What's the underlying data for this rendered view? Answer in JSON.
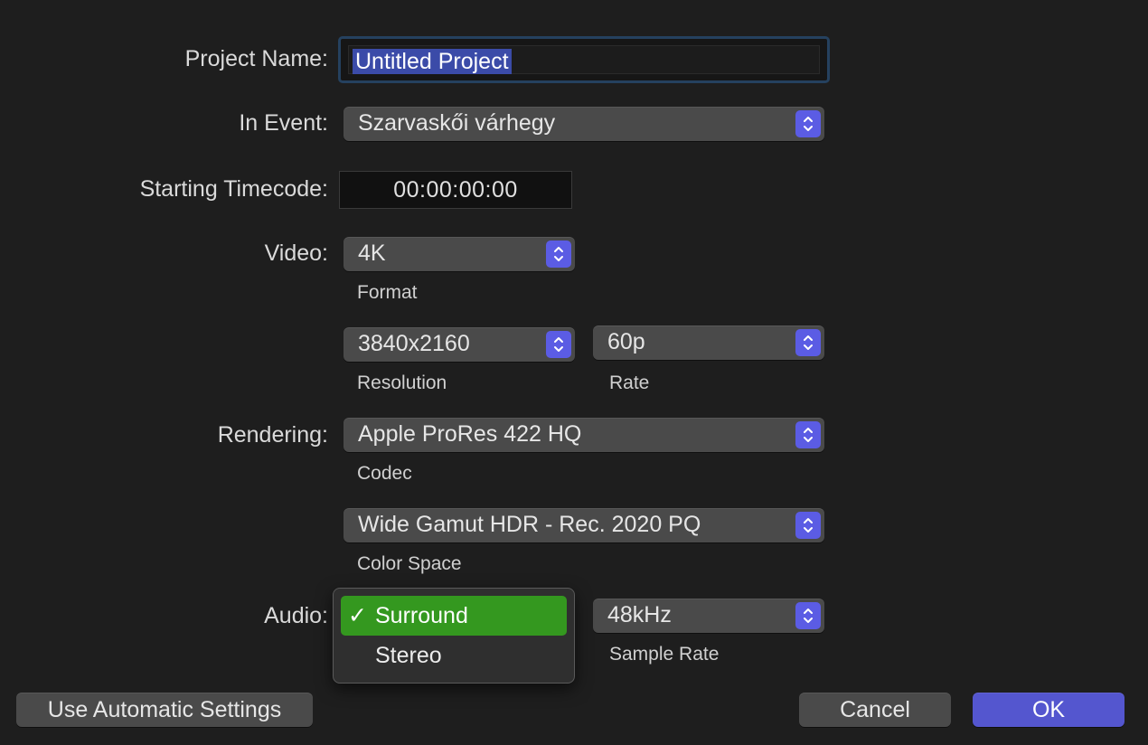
{
  "accent_color": "#5b5ce4",
  "selection_color": "#3b4ba8",
  "menu_highlight_color": "#34981f",
  "fields": {
    "project_name": {
      "label": "Project Name:",
      "value": "Untitled Project"
    },
    "in_event": {
      "label": "In Event:",
      "value": "Szarvaskői várhegy"
    },
    "starting_timecode": {
      "label": "Starting Timecode:",
      "value": "00:00:00:00"
    }
  },
  "video": {
    "label": "Video:",
    "format": {
      "value": "4K",
      "caption": "Format"
    },
    "resolution": {
      "value": "3840x2160",
      "caption": "Resolution"
    },
    "rate": {
      "value": "60p",
      "caption": "Rate"
    }
  },
  "rendering": {
    "label": "Rendering:",
    "codec": {
      "value": "Apple ProRes 422 HQ",
      "caption": "Codec"
    },
    "color_space": {
      "value": "Wide Gamut HDR - Rec. 2020 PQ",
      "caption": "Color Space"
    }
  },
  "audio": {
    "label": "Audio:",
    "menu_options": [
      {
        "label": "Surround",
        "selected": true,
        "check": "✓"
      },
      {
        "label": "Stereo",
        "selected": false
      }
    ],
    "sample_rate": {
      "value": "48kHz",
      "caption": "Sample Rate"
    }
  },
  "buttons": {
    "automatic": "Use Automatic Settings",
    "cancel": "Cancel",
    "ok": "OK"
  },
  "icons": {
    "popup_arrows": "chevron-up-down-icon",
    "checkmark": "checkmark-icon"
  }
}
